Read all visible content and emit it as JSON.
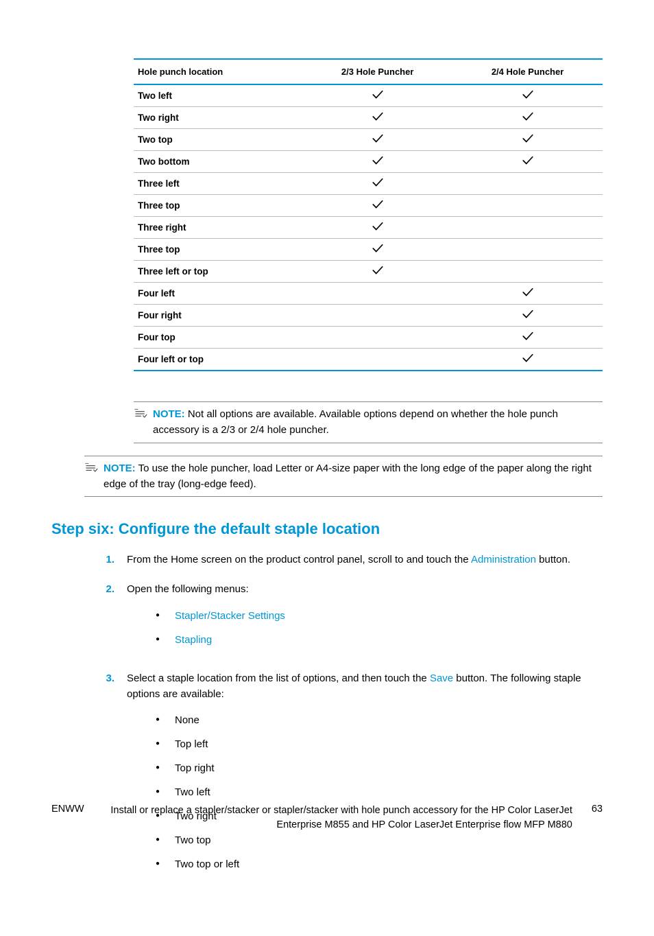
{
  "table": {
    "headers": [
      "Hole punch location",
      "2/3 Hole Puncher",
      "2/4 Hole Puncher"
    ],
    "rows": [
      {
        "label": "Two left",
        "c23": true,
        "c24": true
      },
      {
        "label": "Two right",
        "c23": true,
        "c24": true
      },
      {
        "label": "Two top",
        "c23": true,
        "c24": true
      },
      {
        "label": "Two bottom",
        "c23": true,
        "c24": true
      },
      {
        "label": "Three left",
        "c23": true,
        "c24": false
      },
      {
        "label": "Three top",
        "c23": true,
        "c24": false
      },
      {
        "label": "Three right",
        "c23": true,
        "c24": false
      },
      {
        "label": "Three top",
        "c23": true,
        "c24": false
      },
      {
        "label": "Three left or top",
        "c23": true,
        "c24": false
      },
      {
        "label": "Four left",
        "c23": false,
        "c24": true
      },
      {
        "label": "Four right",
        "c23": false,
        "c24": true
      },
      {
        "label": "Four top",
        "c23": false,
        "c24": true
      },
      {
        "label": "Four left or top",
        "c23": false,
        "c24": true
      }
    ]
  },
  "note1": {
    "label": "NOTE:",
    "text": "Not all options are available. Available options depend on whether the hole punch accessory is a 2/3 or 2/4 hole puncher."
  },
  "note2": {
    "label": "NOTE:",
    "text": "To use the hole puncher, load Letter or A4-size paper with the long edge of the paper along the right edge of the tray (long-edge feed)."
  },
  "heading": "Step six: Configure the default staple location",
  "steps": {
    "s1": {
      "num": "1.",
      "pre": "From the Home screen on the product control panel, scroll to and touch the ",
      "link": "Administration",
      "post": " button."
    },
    "s2": {
      "num": "2.",
      "text": "Open the following menus:",
      "menus": [
        "Stapler/Stacker Settings",
        "Stapling"
      ]
    },
    "s3": {
      "num": "3.",
      "pre": "Select a staple location from the list of options, and then touch the ",
      "link": "Save",
      "post": " button. The following staple options are available:",
      "options": [
        "None",
        "Top left",
        "Top right",
        "Two left",
        "Two right",
        "Two top",
        "Two top or left"
      ]
    }
  },
  "footer": {
    "lang": "ENWW",
    "title": "Install or replace a stapler/stacker or stapler/stacker with hole punch accessory for the HP Color LaserJet Enterprise M855 and HP Color LaserJet Enterprise flow MFP M880",
    "page": "63"
  }
}
